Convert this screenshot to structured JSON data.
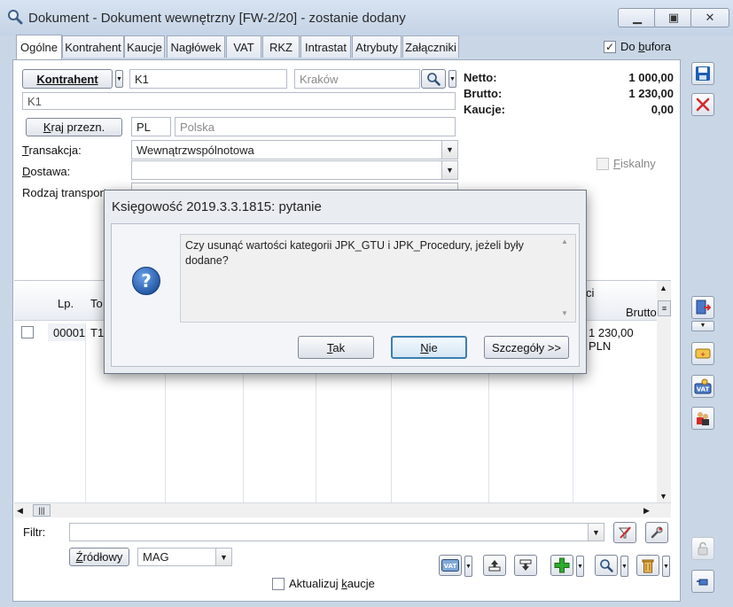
{
  "window": {
    "title": "Dokument - Dokument wewnętrzny [FW-2/20]  - zostanie dodany",
    "min_icon": "minimize-icon",
    "max_icon": "maximize-icon",
    "close_icon": "close-icon"
  },
  "tabs": [
    "Ogólne",
    "Kontrahent",
    "Kaucje",
    "Nagłówek",
    "VAT",
    "RKZ",
    "Intrastat",
    "Atrybuty",
    "Załączniki"
  ],
  "bufor": {
    "label_prefix": "Do ",
    "label_ul": "b",
    "label_rest": "ufora",
    "checked": "✓"
  },
  "form": {
    "kontrahent_button": "Kontrahent",
    "kontrahent_code": "K1",
    "city_placeholder": "Kraków",
    "kontrahent_name": "K1",
    "kraj_button_ul": "K",
    "kraj_button_rest": "raj przezn.",
    "country_code": "PL",
    "country_name": "Polska",
    "transakcja_label_ul": "T",
    "transakcja_label_rest": "ransakcja:",
    "transakcja_value": "Wewnątrzwspólnotowa",
    "dostawa_label_ul": "D",
    "dostawa_label_rest": "ostawa:",
    "dostawa_value": "",
    "rodzaj_label": "Rodzaj transportu:"
  },
  "summary": {
    "netto_label": "Netto:",
    "netto_value": "1 000,00",
    "brutto_label": "Brutto:",
    "brutto_value": "1 230,00",
    "kaucje_label": "Kaucje:",
    "kaucje_value": "0,00"
  },
  "fiskalny": {
    "label_ul": "F",
    "label_rest": "iskalny"
  },
  "grid": {
    "col_lp": "Lp.",
    "col_to": "To",
    "col_ci": "ci",
    "col_brutto": "Brutto",
    "row": {
      "lp": "00001",
      "to": "T1",
      "brutto": "1 230,00 PLN"
    }
  },
  "bottom": {
    "filter_label": "Filtr:",
    "filter_value": "",
    "zrodlowy_button_ul": "Ź",
    "zrodlowy_button_rest": "ródłowy",
    "mag_value": "MAG",
    "aktualizuj_label_prefix": "Aktualizuj ",
    "aktualizuj_label_ul": "k",
    "aktualizuj_label_rest": "aucje"
  },
  "dialog": {
    "title": "Księgowość 2019.3.3.1815: pytanie",
    "message": "Czy usunąć wartości kategorii JPK_GTU i JPK_Procedury, jeżeli były dodane?",
    "icon": "question-icon",
    "yes_ul": "T",
    "yes_rest": "ak",
    "no_ul": "N",
    "no_rest": "ie",
    "details": "Szczegóły >>"
  },
  "colors": {
    "accent": "#3c7fb1",
    "save": "#1e5fb3",
    "cancel": "#d12b2b",
    "add": "#2eaa2e"
  }
}
